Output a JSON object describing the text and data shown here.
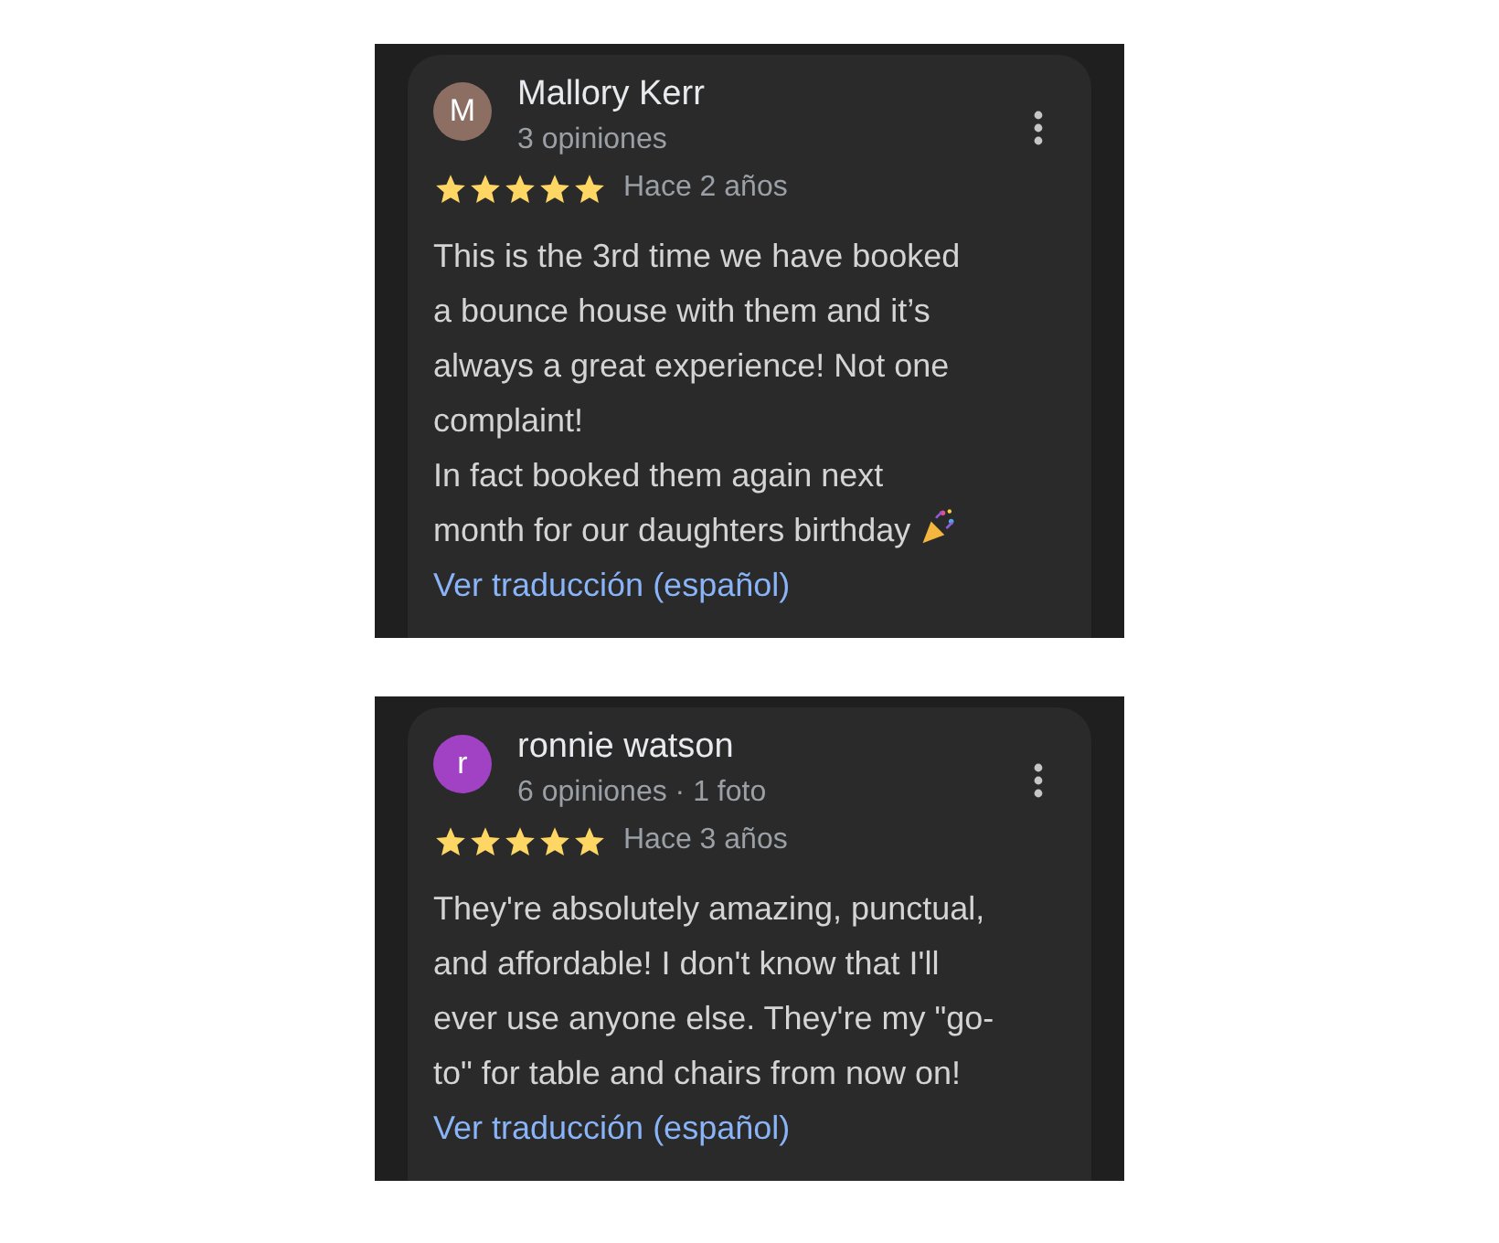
{
  "reviews": [
    {
      "initial": "M",
      "color": "#8d6e63",
      "name": "Mallory Kerr",
      "meta": "3 opiniones",
      "stars": 5,
      "time": "Hace 2 años",
      "lines": [
        "This is the 3rd time we have booked",
        "a bounce house with them and it’s",
        "always a great experience! Not one",
        "complaint!",
        "In fact booked them again next",
        "month for our daughters birthday"
      ],
      "ends_with_party_icon": true,
      "translate_link": "Ver traducción (español)"
    },
    {
      "initial": "r",
      "color": "#a142c4",
      "name": "ronnie watson",
      "meta": "6 opiniones · 1 foto",
      "stars": 5,
      "time": "Hace 3 años",
      "lines": [
        "They're absolutely amazing, punctual,",
        "and affordable! I don't know that I'll",
        "ever use anyone else. They're my \"go-",
        "to\" for table and chairs from now on!"
      ],
      "ends_with_party_icon": false,
      "translate_link": "Ver traducción (español)"
    }
  ]
}
